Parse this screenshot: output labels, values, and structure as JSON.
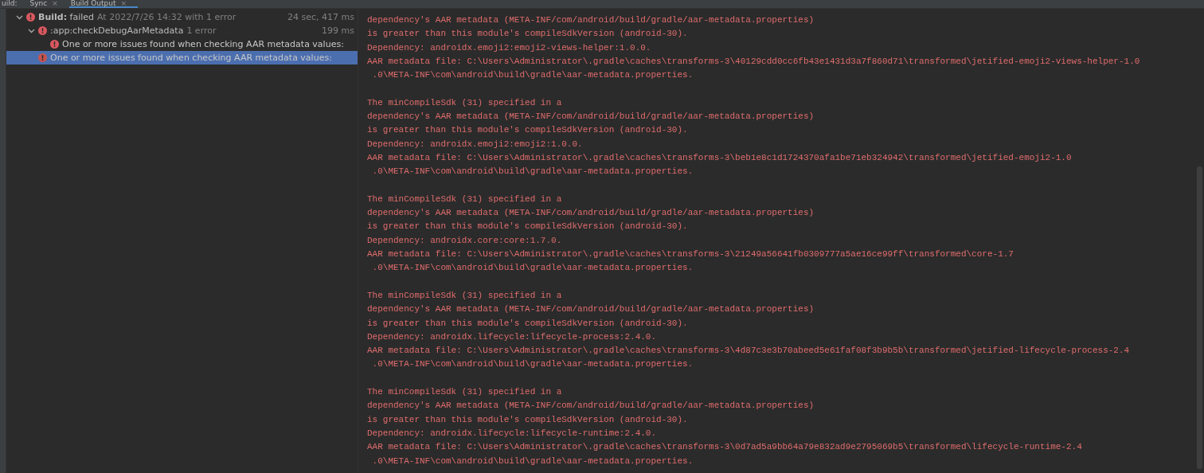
{
  "tabs": [
    {
      "label": "uild:",
      "selected": false
    },
    {
      "label": "Sync",
      "selected": false,
      "close": "×"
    },
    {
      "label": "Build Output",
      "selected": true,
      "close": "×"
    }
  ],
  "tree": [
    {
      "kind": "build",
      "title": "Build:",
      "status": "failed",
      "detail": "At 2022/7/26 14:32 with 1 error",
      "time": "24 sec, 417 ms",
      "expanded": true,
      "selected": false,
      "children": [
        {
          "kind": "task",
          "title": ":app:checkDebugAarMetadata",
          "detail": "1 error",
          "time": "199 ms",
          "expanded": true,
          "selected": false,
          "children": [
            {
              "kind": "message",
              "title": "One or more issues found when checking AAR metadata values:",
              "selected": false
            }
          ]
        },
        {
          "kind": "message",
          "title": "One or more issues found when checking AAR metadata values:",
          "selected": true
        }
      ]
    }
  ],
  "console": [
    {
      "lines": [
        "dependency's AAR metadata (META-INF/com/android/build/gradle/aar-metadata.properties)",
        "is greater than this module's compileSdkVersion (android-30).",
        "Dependency: androidx.emoji2:emoji2-views-helper:1.0.0.",
        "AAR metadata file: C:\\Users\\Administrator\\.gradle\\caches\\transforms-3\\40129cdd0cc6fb43e1431d3a7f860d71\\transformed\\jetified-emoji2-views-helper-1.0",
        " .0\\META-INF\\com\\android\\build\\gradle\\aar-metadata.properties."
      ]
    },
    {
      "lines": [
        "The minCompileSdk (31) specified in a",
        "dependency's AAR metadata (META-INF/com/android/build/gradle/aar-metadata.properties)",
        "is greater than this module's compileSdkVersion (android-30).",
        "Dependency: androidx.emoji2:emoji2:1.0.0.",
        "AAR metadata file: C:\\Users\\Administrator\\.gradle\\caches\\transforms-3\\beb1e8c1d1724370afa1be71eb324942\\transformed\\jetified-emoji2-1.0",
        " .0\\META-INF\\com\\android\\build\\gradle\\aar-metadata.properties."
      ]
    },
    {
      "lines": [
        "The minCompileSdk (31) specified in a",
        "dependency's AAR metadata (META-INF/com/android/build/gradle/aar-metadata.properties)",
        "is greater than this module's compileSdkVersion (android-30).",
        "Dependency: androidx.core:core:1.7.0.",
        "AAR metadata file: C:\\Users\\Administrator\\.gradle\\caches\\transforms-3\\21249a56641fb0309777a5ae16ce99ff\\transformed\\core-1.7",
        " .0\\META-INF\\com\\android\\build\\gradle\\aar-metadata.properties."
      ]
    },
    {
      "lines": [
        "The minCompileSdk (31) specified in a",
        "dependency's AAR metadata (META-INF/com/android/build/gradle/aar-metadata.properties)",
        "is greater than this module's compileSdkVersion (android-30).",
        "Dependency: androidx.lifecycle:lifecycle-process:2.4.0.",
        "AAR metadata file: C:\\Users\\Administrator\\.gradle\\caches\\transforms-3\\4d87c3e3b70abeed5e61faf08f3b9b5b\\transformed\\jetified-lifecycle-process-2.4",
        " .0\\META-INF\\com\\android\\build\\gradle\\aar-metadata.properties."
      ]
    },
    {
      "lines": [
        "The minCompileSdk (31) specified in a",
        "dependency's AAR metadata (META-INF/com/android/build/gradle/aar-metadata.properties)",
        "is greater than this module's compileSdkVersion (android-30).",
        "Dependency: androidx.lifecycle:lifecycle-runtime:2.4.0.",
        "AAR metadata file: C:\\Users\\Administrator\\.gradle\\caches\\transforms-3\\0d7ad5a9bb64a79e832ad9e2795069b5\\transformed\\lifecycle-runtime-2.4",
        " .0\\META-INF\\com\\android\\build\\gradle\\aar-metadata.properties."
      ]
    }
  ]
}
